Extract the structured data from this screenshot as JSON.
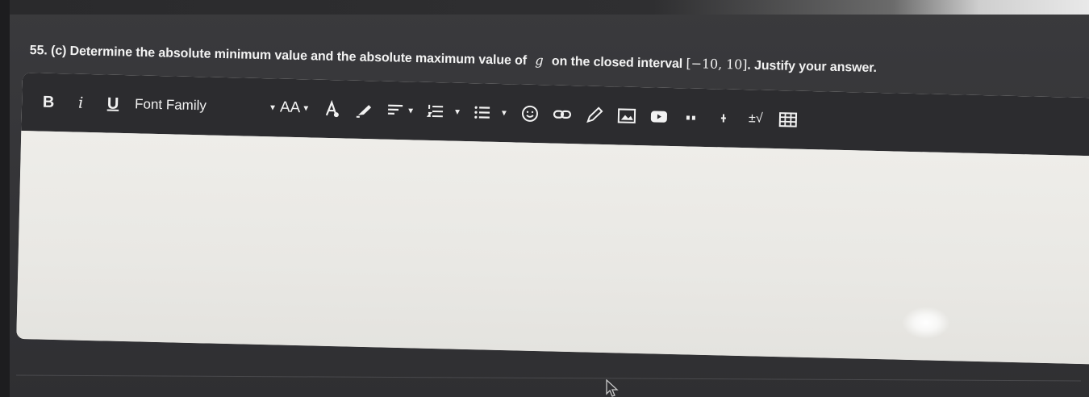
{
  "question": {
    "prefix": "55. (c) Determine the absolute minimum value and the absolute maximum value of",
    "variable": "g",
    "middle": "on the closed interval",
    "interval": "[−10, 10]",
    "suffix": ". Justify your answer."
  },
  "toolbar": {
    "bold_label": "B",
    "italic_label": "i",
    "underline_label": "U",
    "font_family_label": "Font Family",
    "font_size_label": "AA",
    "math_label": "±√"
  },
  "colors": {
    "toolbar_bg": "#2c2c2f",
    "editor_bg": "#ebeae6",
    "page_bg": "#353538"
  },
  "icons": [
    "font-color-icon",
    "highlighter-icon",
    "align-icon",
    "ordered-list-icon",
    "bullet-list-icon",
    "emoji-icon",
    "link-icon",
    "draw-icon",
    "image-icon",
    "video-icon",
    "quote-icon",
    "special-char-icon",
    "table-icon"
  ]
}
